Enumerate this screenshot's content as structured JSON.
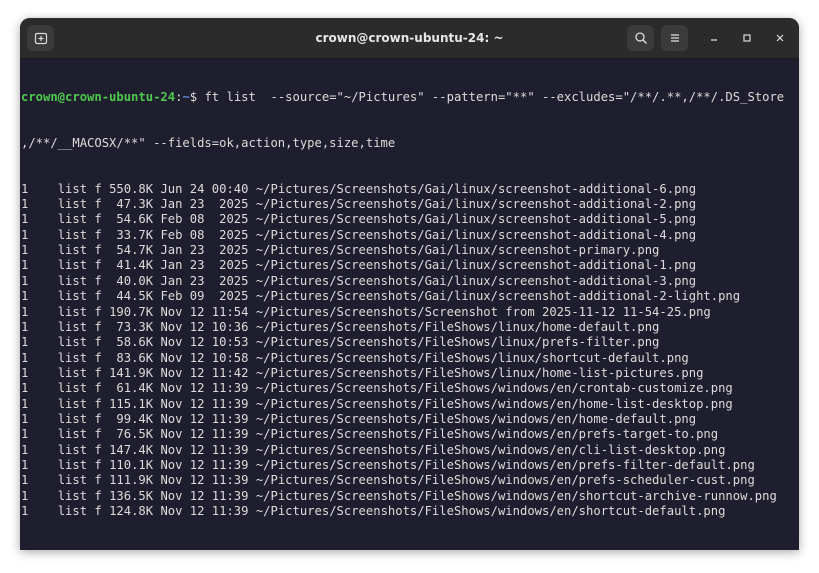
{
  "window": {
    "title": "crown@crown-ubuntu-24: ~"
  },
  "icons": {
    "new_tab": "new-tab-icon",
    "search": "search-icon",
    "menu": "hamburger-menu-icon",
    "minimize": "minimize-icon",
    "maximize": "maximize-icon",
    "close": "close-icon"
  },
  "colors": {
    "prompt_user": "#4ec94e",
    "prompt_path": "#5a8fd6",
    "terminal_bg": "#1e1e2e",
    "titlebar_bg": "#2b2b2b"
  },
  "terminal": {
    "prompt_user": "crown@crown-ubuntu-24",
    "prompt_sep": ":",
    "prompt_path": "~",
    "prompt_symbol": "$ ",
    "command_line_1": "ft list  --source=\"~/Pictures\" --pattern=\"**\" --excludes=\"/**/.**,/**/.DS_Store",
    "command_line_2": ",/**/__MACOSX/**\" --fields=ok,action,type,size,time",
    "rows": [
      {
        "ok": "1",
        "action": "list",
        "type": "f",
        "size": "550.8K",
        "time": "Jun 24 00:40",
        "path": "~/Pictures/Screenshots/Gai/linux/screenshot-additional-6.png"
      },
      {
        "ok": "1",
        "action": "list",
        "type": "f",
        "size": "47.3K",
        "time": "Jan 23  2025",
        "path": "~/Pictures/Screenshots/Gai/linux/screenshot-additional-2.png"
      },
      {
        "ok": "1",
        "action": "list",
        "type": "f",
        "size": "54.6K",
        "time": "Feb 08  2025",
        "path": "~/Pictures/Screenshots/Gai/linux/screenshot-additional-5.png"
      },
      {
        "ok": "1",
        "action": "list",
        "type": "f",
        "size": "33.7K",
        "time": "Feb 08  2025",
        "path": "~/Pictures/Screenshots/Gai/linux/screenshot-additional-4.png"
      },
      {
        "ok": "1",
        "action": "list",
        "type": "f",
        "size": "54.7K",
        "time": "Jan 23  2025",
        "path": "~/Pictures/Screenshots/Gai/linux/screenshot-primary.png"
      },
      {
        "ok": "1",
        "action": "list",
        "type": "f",
        "size": "41.4K",
        "time": "Jan 23  2025",
        "path": "~/Pictures/Screenshots/Gai/linux/screenshot-additional-1.png"
      },
      {
        "ok": "1",
        "action": "list",
        "type": "f",
        "size": "40.0K",
        "time": "Jan 23  2025",
        "path": "~/Pictures/Screenshots/Gai/linux/screenshot-additional-3.png"
      },
      {
        "ok": "1",
        "action": "list",
        "type": "f",
        "size": "44.5K",
        "time": "Feb 09  2025",
        "path": "~/Pictures/Screenshots/Gai/linux/screenshot-additional-2-light.png"
      },
      {
        "ok": "1",
        "action": "list",
        "type": "f",
        "size": "190.7K",
        "time": "Nov 12 11:54",
        "path": "~/Pictures/Screenshots/Screenshot from 2025-11-12 11-54-25.png"
      },
      {
        "ok": "1",
        "action": "list",
        "type": "f",
        "size": "73.3K",
        "time": "Nov 12 10:36",
        "path": "~/Pictures/Screenshots/FileShows/linux/home-default.png"
      },
      {
        "ok": "1",
        "action": "list",
        "type": "f",
        "size": "58.6K",
        "time": "Nov 12 10:53",
        "path": "~/Pictures/Screenshots/FileShows/linux/prefs-filter.png"
      },
      {
        "ok": "1",
        "action": "list",
        "type": "f",
        "size": "83.6K",
        "time": "Nov 12 10:58",
        "path": "~/Pictures/Screenshots/FileShows/linux/shortcut-default.png"
      },
      {
        "ok": "1",
        "action": "list",
        "type": "f",
        "size": "141.9K",
        "time": "Nov 12 11:42",
        "path": "~/Pictures/Screenshots/FileShows/linux/home-list-pictures.png"
      },
      {
        "ok": "1",
        "action": "list",
        "type": "f",
        "size": "61.4K",
        "time": "Nov 12 11:39",
        "path": "~/Pictures/Screenshots/FileShows/windows/en/crontab-customize.png"
      },
      {
        "ok": "1",
        "action": "list",
        "type": "f",
        "size": "115.1K",
        "time": "Nov 12 11:39",
        "path": "~/Pictures/Screenshots/FileShows/windows/en/home-list-desktop.png"
      },
      {
        "ok": "1",
        "action": "list",
        "type": "f",
        "size": "99.4K",
        "time": "Nov 12 11:39",
        "path": "~/Pictures/Screenshots/FileShows/windows/en/home-default.png"
      },
      {
        "ok": "1",
        "action": "list",
        "type": "f",
        "size": "76.5K",
        "time": "Nov 12 11:39",
        "path": "~/Pictures/Screenshots/FileShows/windows/en/prefs-target-to.png"
      },
      {
        "ok": "1",
        "action": "list",
        "type": "f",
        "size": "147.4K",
        "time": "Nov 12 11:39",
        "path": "~/Pictures/Screenshots/FileShows/windows/en/cli-list-desktop.png"
      },
      {
        "ok": "1",
        "action": "list",
        "type": "f",
        "size": "110.1K",
        "time": "Nov 12 11:39",
        "path": "~/Pictures/Screenshots/FileShows/windows/en/prefs-filter-default.png"
      },
      {
        "ok": "1",
        "action": "list",
        "type": "f",
        "size": "111.9K",
        "time": "Nov 12 11:39",
        "path": "~/Pictures/Screenshots/FileShows/windows/en/prefs-scheduler-cust.png"
      },
      {
        "ok": "1",
        "action": "list",
        "type": "f",
        "size": "136.5K",
        "time": "Nov 12 11:39",
        "path": "~/Pictures/Screenshots/FileShows/windows/en/shortcut-archive-runnow.png"
      },
      {
        "ok": "1",
        "action": "list",
        "type": "f",
        "size": "124.8K",
        "time": "Nov 12 11:39",
        "path": "~/Pictures/Screenshots/FileShows/windows/en/shortcut-default.png"
      }
    ]
  }
}
